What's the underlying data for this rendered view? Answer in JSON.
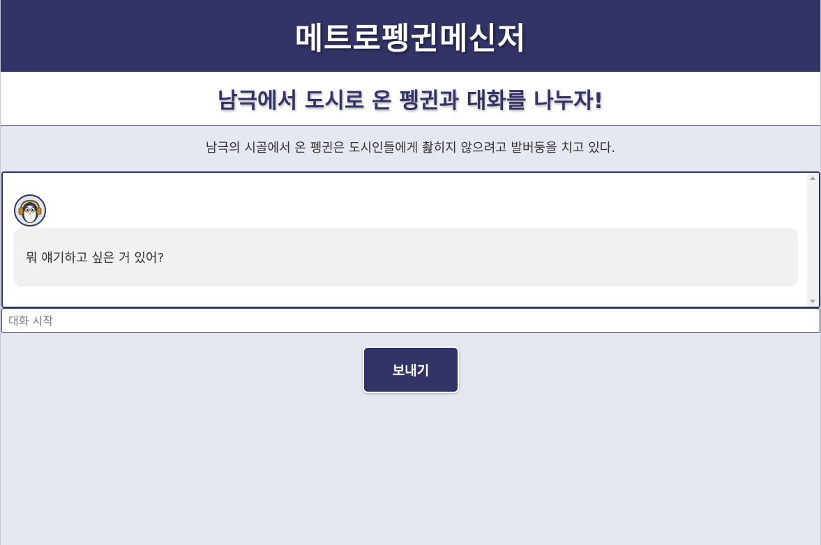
{
  "header": {
    "app_title": "메트로펭귄메신저",
    "subtitle": "남극에서 도시로 온 펭귄과 대화를 나누자!",
    "description": "남극의 시골에서 온 펭귄은 도시인들에게 촲히지 않으려고 발버둥을 치고 있다."
  },
  "chat": {
    "messages": [
      {
        "sender_avatar_icon": "penguin-with-headphones-icon",
        "text": "뭐 얘기하고 싶은 거 있어?"
      }
    ]
  },
  "input": {
    "placeholder": "대화 시작",
    "value": ""
  },
  "actions": {
    "send_label": "보내기"
  },
  "colors": {
    "primary": "#323366",
    "background": "#e5e8f0",
    "bubble": "#f0f1f3"
  }
}
